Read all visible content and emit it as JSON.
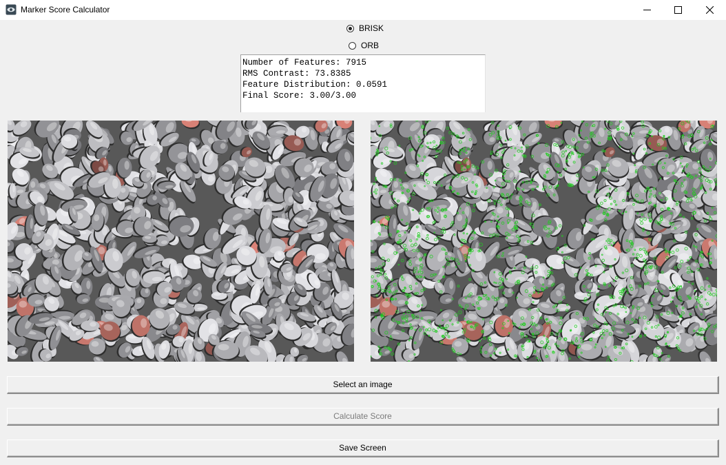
{
  "window": {
    "title": "Marker Score Calculator",
    "icon": "camera-app-icon",
    "controls": [
      "minimize-icon",
      "maximize-icon",
      "close-icon"
    ]
  },
  "detector": {
    "options": [
      {
        "label": "BRISK",
        "selected": true
      },
      {
        "label": "ORB",
        "selected": false
      }
    ]
  },
  "results": {
    "lines": [
      "Number of Features: 7915",
      "RMS Contrast: 73.8385",
      "Feature Distribution: 0.0591",
      "Final Score: 3.00/3.00"
    ]
  },
  "images": {
    "original": "gravel-stones-photo",
    "features": "gravel-stones-photo-with-green-keypoints",
    "keypoint_color": "#22cc22"
  },
  "buttons": {
    "select": "Select an image",
    "calculate": "Calculate Score",
    "save": "Save Screen"
  }
}
